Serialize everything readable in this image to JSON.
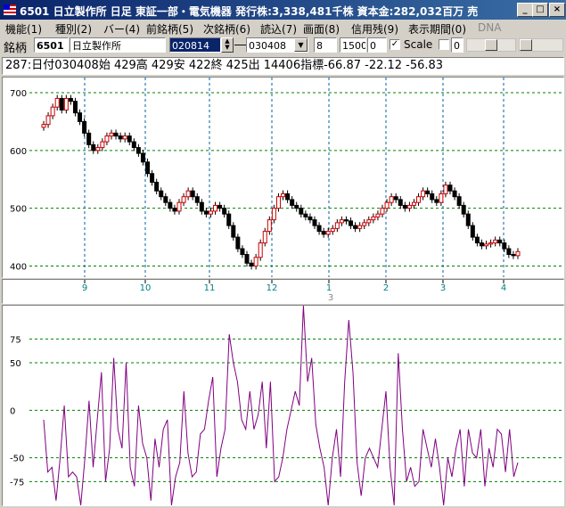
{
  "titlebar": {
    "title": "6501 日立製作所 日足 東証一部・電気機器 発行株:3,338,481千株 資本金:282,032百万 売",
    "minimize": "_",
    "maximize": "□",
    "close": "×"
  },
  "menu": [
    {
      "label": "機能(1)"
    },
    {
      "label": "種別(2)"
    },
    {
      "label": "バー(4)"
    },
    {
      "label": "前銘柄(5)"
    },
    {
      "label": "次銘柄(6)"
    },
    {
      "label": "読込(7)"
    },
    {
      "label": "画面(8)"
    },
    {
      "label": "信用残(9)"
    },
    {
      "label": "表示期間(0)"
    },
    {
      "label": "DNA"
    }
  ],
  "toolbar": {
    "label": "銘柄",
    "code": "6501",
    "name": "日立製作所",
    "from_date": "020814",
    "dash": "―",
    "to_date": "030408",
    "field_a": "8",
    "field_b": "1500",
    "field_c": "0",
    "scale_label": "Scale",
    "scale_checked": true,
    "field_d": "0"
  },
  "info": {
    "text": "287:日付030408始 429高 429安 422終 425出 14406指標-66.87 -22.12 -56.83"
  },
  "colors": {
    "up_candle": "#cc0000",
    "down_candle": "#000000",
    "indicator": "#800080",
    "grid": "#008000",
    "axis_label": "#008080"
  },
  "chart_data": [
    {
      "type": "candlestick",
      "ylim": [
        390,
        720
      ],
      "yticks": [
        400,
        500,
        600,
        700
      ],
      "xticks": [
        "9",
        "10",
        "11",
        "12",
        "1",
        "2",
        "3",
        "4"
      ],
      "xtick_secondary": "3",
      "grid": true,
      "close": [
        645,
        660,
        675,
        690,
        670,
        690,
        685,
        665,
        650,
        630,
        610,
        600,
        605,
        615,
        625,
        630,
        625,
        620,
        625,
        615,
        605,
        595,
        580,
        560,
        545,
        530,
        520,
        510,
        500,
        495,
        510,
        520,
        530,
        520,
        510,
        495,
        490,
        495,
        505,
        500,
        490,
        470,
        450,
        430,
        420,
        405,
        400,
        415,
        440,
        460,
        480,
        500,
        520,
        525,
        515,
        505,
        500,
        490,
        485,
        480,
        470,
        460,
        455,
        460,
        465,
        475,
        480,
        478,
        470,
        465,
        470,
        475,
        480,
        485,
        490,
        500,
        510,
        520,
        515,
        505,
        500,
        505,
        510,
        520,
        530,
        525,
        515,
        510,
        525,
        540,
        530,
        520,
        505,
        490,
        470,
        450,
        440,
        435,
        438,
        440,
        445,
        440,
        430,
        420,
        418,
        425
      ],
      "volatility_hint": "approximate closes read from chart"
    },
    {
      "type": "line",
      "ylim": [
        -100,
        110
      ],
      "yticks": [
        75,
        50,
        0,
        -50,
        -75
      ],
      "series": [
        {
          "values": [
            -10,
            -65,
            -60,
            -95,
            -50,
            5,
            -70,
            -65,
            -70,
            -100,
            -50,
            10,
            -60,
            -10,
            40,
            -75,
            -40,
            55,
            -20,
            -40,
            50,
            -60,
            -80,
            5,
            -35,
            -50,
            -95,
            -30,
            -60,
            -20,
            -10,
            -100,
            -70,
            -55,
            20,
            -45,
            -70,
            -65,
            -25,
            -20,
            10,
            35,
            -70,
            -40,
            -20,
            80,
            50,
            30,
            -10,
            -20,
            20,
            -20,
            -5,
            30,
            -40,
            30,
            -75,
            -70,
            -50,
            -20,
            0,
            20,
            5,
            110,
            30,
            55,
            -15,
            -40,
            -60,
            -100,
            -50,
            -20,
            -70,
            30,
            95,
            40,
            -55,
            -90,
            -50,
            -40,
            -50,
            -60,
            -20,
            20,
            -60,
            -100,
            60,
            -20,
            -75,
            -60,
            -80,
            -75,
            -20,
            -40,
            -60,
            -30,
            -60,
            -100,
            -50,
            -70,
            -40,
            -20,
            -80,
            -20,
            -45,
            -50,
            -20,
            -80,
            -40,
            -60,
            -20,
            -25,
            -65,
            -20,
            -70,
            -55
          ]
        }
      ]
    }
  ]
}
